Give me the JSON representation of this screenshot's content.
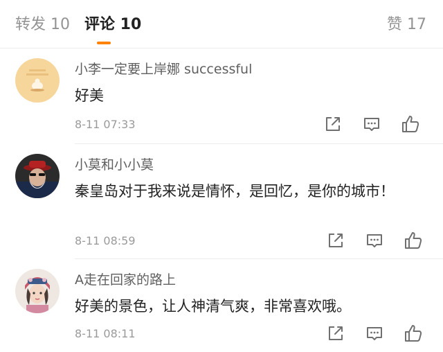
{
  "tabs": {
    "repost": "转发 10",
    "comment": "评论 10",
    "like": "赞 17"
  },
  "colors": {
    "accent": "#ff8200",
    "text_primary": "#222222",
    "text_secondary": "#5f5f5f",
    "text_muted": "#9a9a9a"
  },
  "comments": [
    {
      "username": "小李一定要上岸娜 successful",
      "text": "好美",
      "time": "8-11 07:33",
      "avatar_icon": "avatar-cartoon-icon"
    },
    {
      "username": "小莫和小小莫",
      "text": "秦皇岛对于我来说是情怀，是回忆，是你的城市！",
      "time": "8-11 08:59",
      "avatar_icon": "avatar-man-hat-icon"
    },
    {
      "username": "A走在回家的路上",
      "text": "好美的景色，让人神清气爽，非常喜欢哦。",
      "time": "8-11 08:11",
      "avatar_icon": "avatar-illustrated-girl-icon"
    }
  ],
  "action_icons": [
    "share-icon",
    "reply-icon",
    "thumbs-up-icon"
  ]
}
